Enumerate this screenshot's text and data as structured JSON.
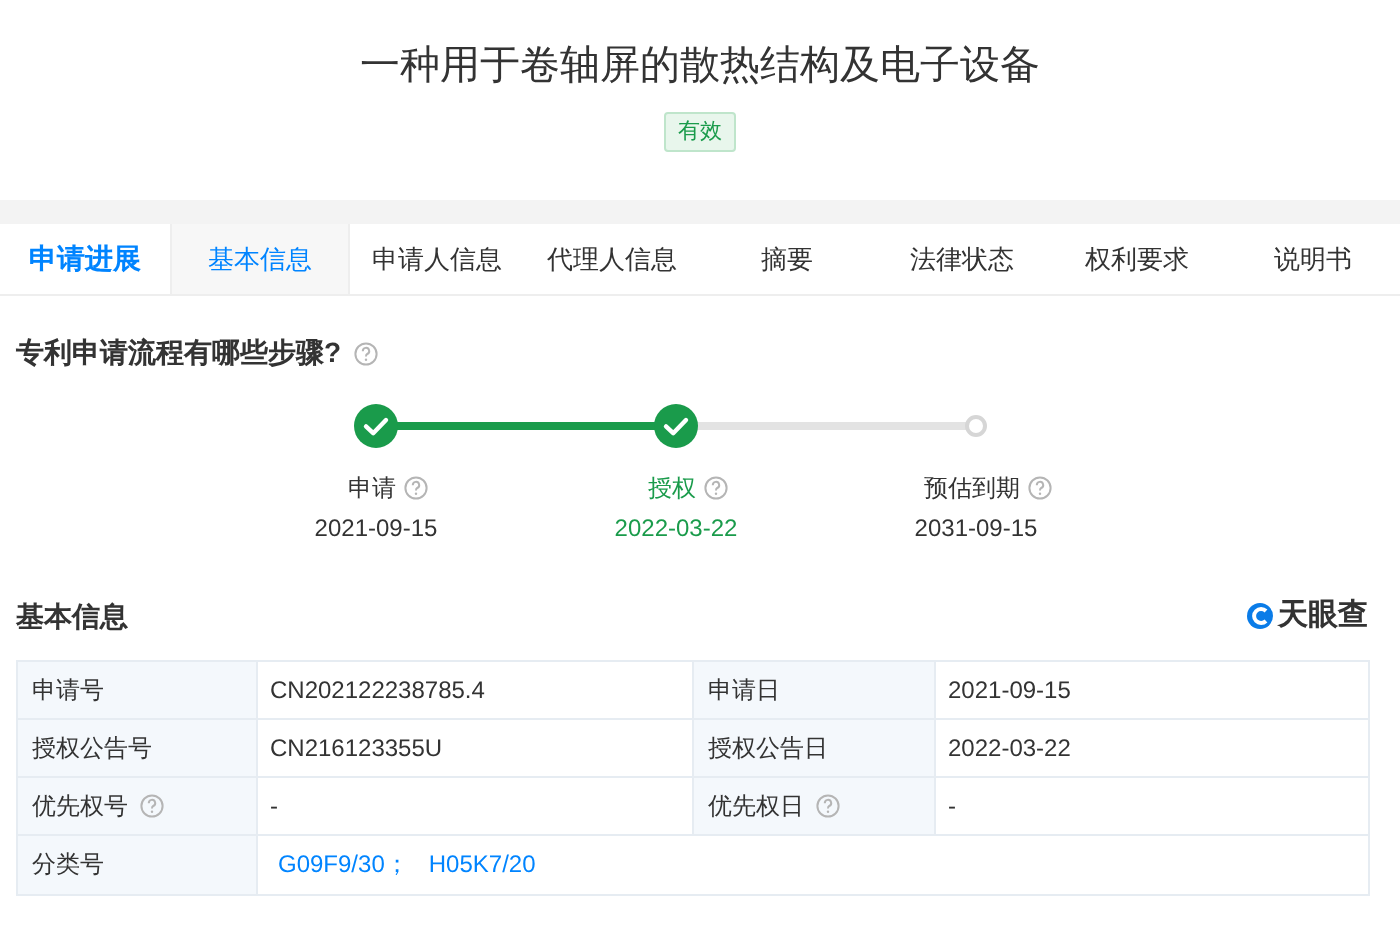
{
  "title": "一种用于卷轴屏的散热结构及电子设备",
  "status_badge": "有效",
  "section_tab": "申请进展",
  "tabs": [
    {
      "label": "基本信息",
      "selected": true
    },
    {
      "label": "申请人信息",
      "selected": false
    },
    {
      "label": "代理人信息",
      "selected": false
    },
    {
      "label": "摘要",
      "selected": false
    },
    {
      "label": "法律状态",
      "selected": false
    },
    {
      "label": "权利要求",
      "selected": false
    },
    {
      "label": "说明书",
      "selected": false
    }
  ],
  "process_heading": "专利申请流程有哪些步骤?",
  "steps": [
    {
      "label": "申请",
      "date": "2021-09-15",
      "done": true,
      "selected": false
    },
    {
      "label": "授权",
      "date": "2022-03-22",
      "done": true,
      "selected": true
    },
    {
      "label": "预估到期",
      "date": "2031-09-15",
      "done": false,
      "selected": false
    }
  ],
  "info_heading": "基本信息",
  "logo_text": "天眼查",
  "table": {
    "rows": [
      {
        "cells": [
          {
            "label": "申请号",
            "value": "CN202122238785.4",
            "help": false
          },
          {
            "label": "申请日",
            "value": "2021-09-15",
            "help": false
          }
        ]
      },
      {
        "cells": [
          {
            "label": "授权公告号",
            "value": "CN216123355U",
            "help": false
          },
          {
            "label": "授权公告日",
            "value": "2022-03-22",
            "help": false
          }
        ]
      },
      {
        "cells": [
          {
            "label": "优先权号",
            "value": "-",
            "help": true
          },
          {
            "label": "优先权日",
            "value": "-",
            "help": true
          }
        ]
      }
    ],
    "classification": {
      "label": "分类号",
      "codes": [
        "G09F9/30；",
        "H05K7/20"
      ]
    }
  }
}
